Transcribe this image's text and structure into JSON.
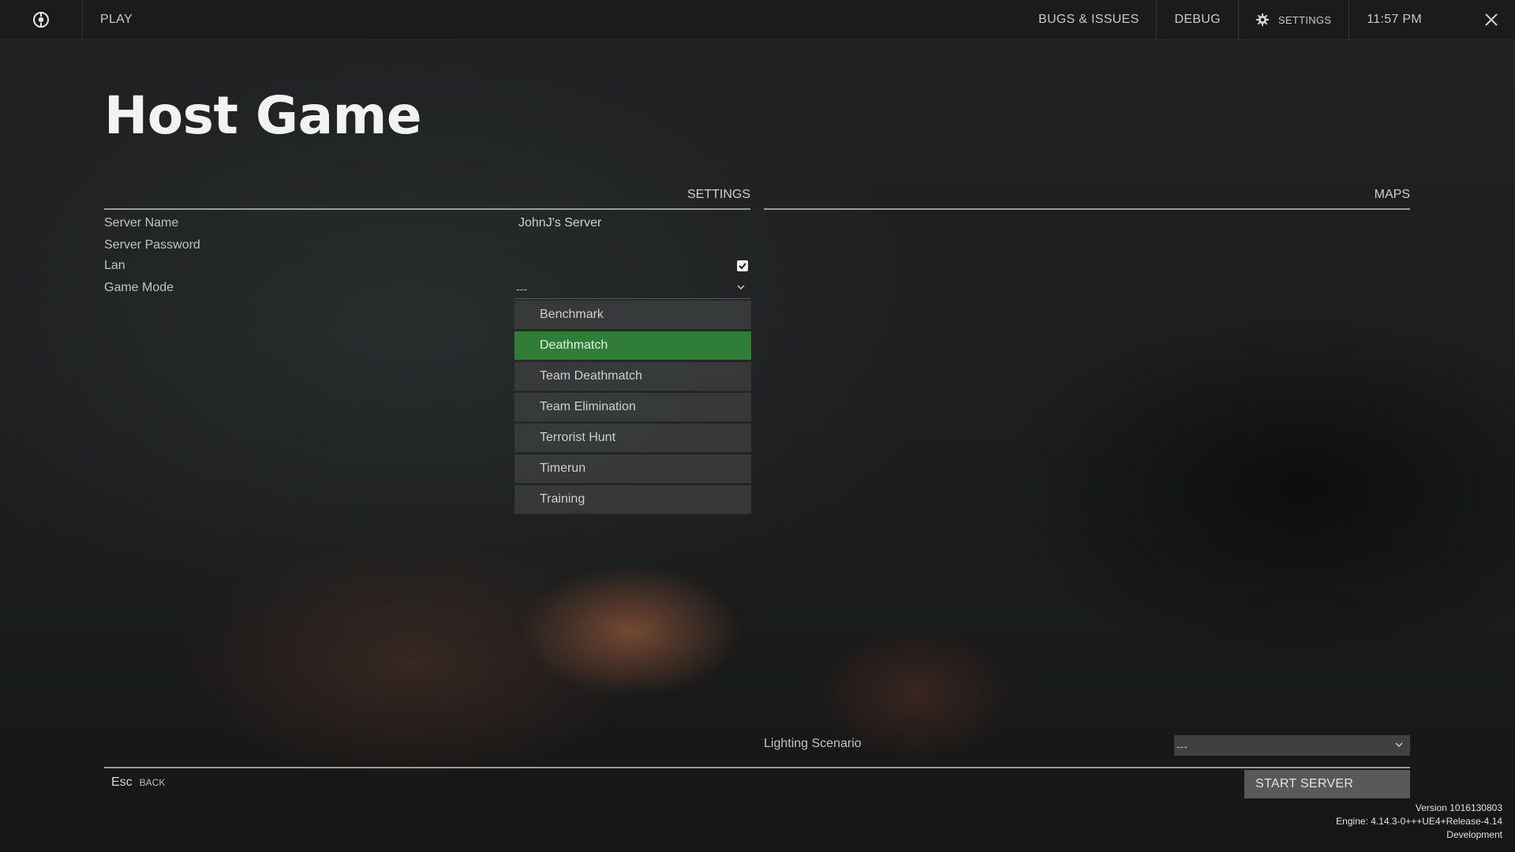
{
  "topbar": {
    "play": "PLAY",
    "bugs": "BUGS & ISSUES",
    "debug": "DEBUG",
    "settings": "SETTINGS",
    "clock": "11:57 PM"
  },
  "page": {
    "title": "Host Game"
  },
  "settings_section": {
    "heading": "SETTINGS",
    "server_name_label": "Server Name",
    "server_name_value": "JohnJ's Server",
    "server_password_label": "Server Password",
    "lan_label": "Lan",
    "lan_checked": true,
    "game_mode_label": "Game Mode",
    "game_mode_value": "---",
    "game_mode_options": [
      "Benchmark",
      "Deathmatch",
      "Team Deathmatch",
      "Team Elimination",
      "Terrorist Hunt",
      "Timerun",
      "Training"
    ],
    "highlighted_option": "Deathmatch"
  },
  "maps_section": {
    "heading": "MAPS",
    "lighting_label": "Lighting Scenario",
    "lighting_value": "---"
  },
  "footer": {
    "back_key": "Esc",
    "back_label": "BACK",
    "start_label": "START SERVER",
    "version": "Version 1016130803",
    "engine": "Engine: 4.14.3-0+++UE4+Release-4.14",
    "build": "Development"
  },
  "icons": {
    "logo": "game-logo-icon",
    "settings": "gear-icon",
    "close": "close-icon",
    "checkbox": "checkmark-icon",
    "dropdown": "chevron-down-icon"
  },
  "colors": {
    "highlight": "#2f7d36",
    "button": "#585a5a",
    "background": "#1b1c1c"
  }
}
